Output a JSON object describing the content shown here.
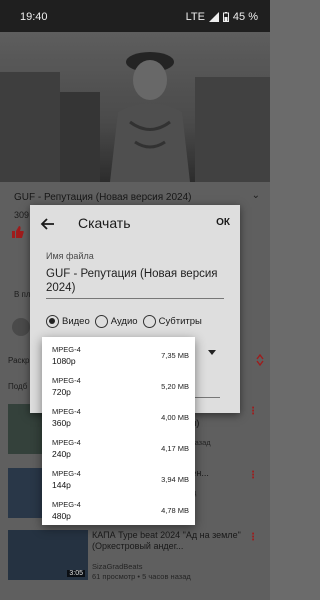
{
  "status_bar": {
    "time": "19:40",
    "network": "LTE",
    "battery": "45 %"
  },
  "video": {
    "title": "GUF - Репутация (Новая версия 2024)",
    "views_fragment": "309"
  },
  "background_fragments": {
    "v_pl": "В пл",
    "raskr": "Раскр",
    "podb": "Подб"
  },
  "related": [
    {
      "title_fragment": "Клип)",
      "meta_fragment": "цев назад",
      "duration": ""
    },
    {
      "title_fragment": "Зелен...",
      "meta_fragment": "назад",
      "duration": ""
    },
    {
      "title": "КАПА Type beat 2024 \"Ад на земле\" (Оркестровый андег...",
      "channel": "SizaGradBeats",
      "meta": "61 просмотр • 5 часов назад",
      "duration": "3:05"
    }
  ],
  "dialog": {
    "title": "Скачать",
    "ok_label": "ОК",
    "filename_label": "Имя файла",
    "filename_value": "GUF - Репутация (Новая версия 2024)",
    "options": [
      {
        "label": "Видео",
        "selected": true
      },
      {
        "label": "Аудио",
        "selected": false
      },
      {
        "label": "Субтитры",
        "selected": false
      }
    ]
  },
  "format_menu": [
    {
      "format": "MPEG-4",
      "resolution": "1080p",
      "size": "7,35 MB"
    },
    {
      "format": "MPEG-4",
      "resolution": "720p",
      "size": "5,20 MB"
    },
    {
      "format": "MPEG-4",
      "resolution": "360p",
      "size": "4,00 MB"
    },
    {
      "format": "MPEG-4",
      "resolution": "240p",
      "size": "4,17 MB"
    },
    {
      "format": "MPEG-4",
      "resolution": "144p",
      "size": "3,94 MB"
    },
    {
      "format": "MPEG-4",
      "resolution": "480p",
      "size": "4,78 MB"
    }
  ],
  "colors": {
    "accent_red": "#b52020",
    "dialog_bg": "#dedede",
    "menu_bg": "#ffffff"
  }
}
